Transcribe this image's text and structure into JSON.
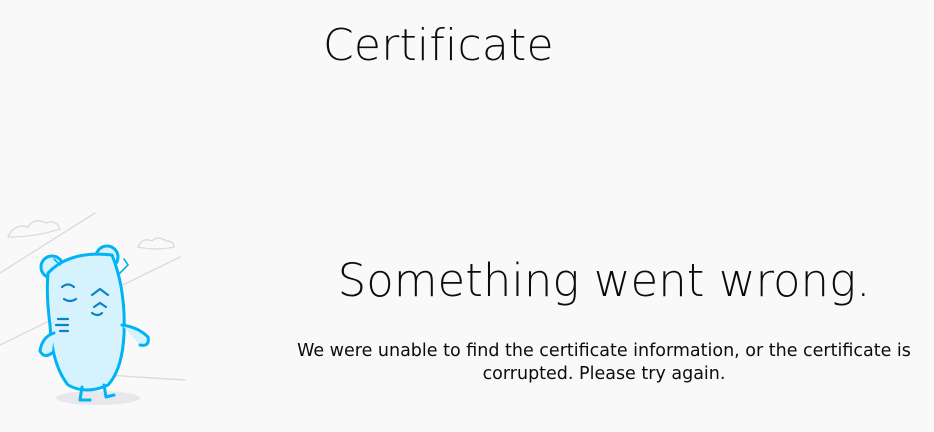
{
  "header": {
    "title": "Certificate"
  },
  "error": {
    "title": "Something went wrong.",
    "message": "We were unable to find the certificate information, or the certificate is corrupted. Please try again."
  },
  "illustration": {
    "icon": "broken-robot-character-icon",
    "stroke_color": "#00b3f4",
    "fill_color": "#d6f2fd"
  }
}
